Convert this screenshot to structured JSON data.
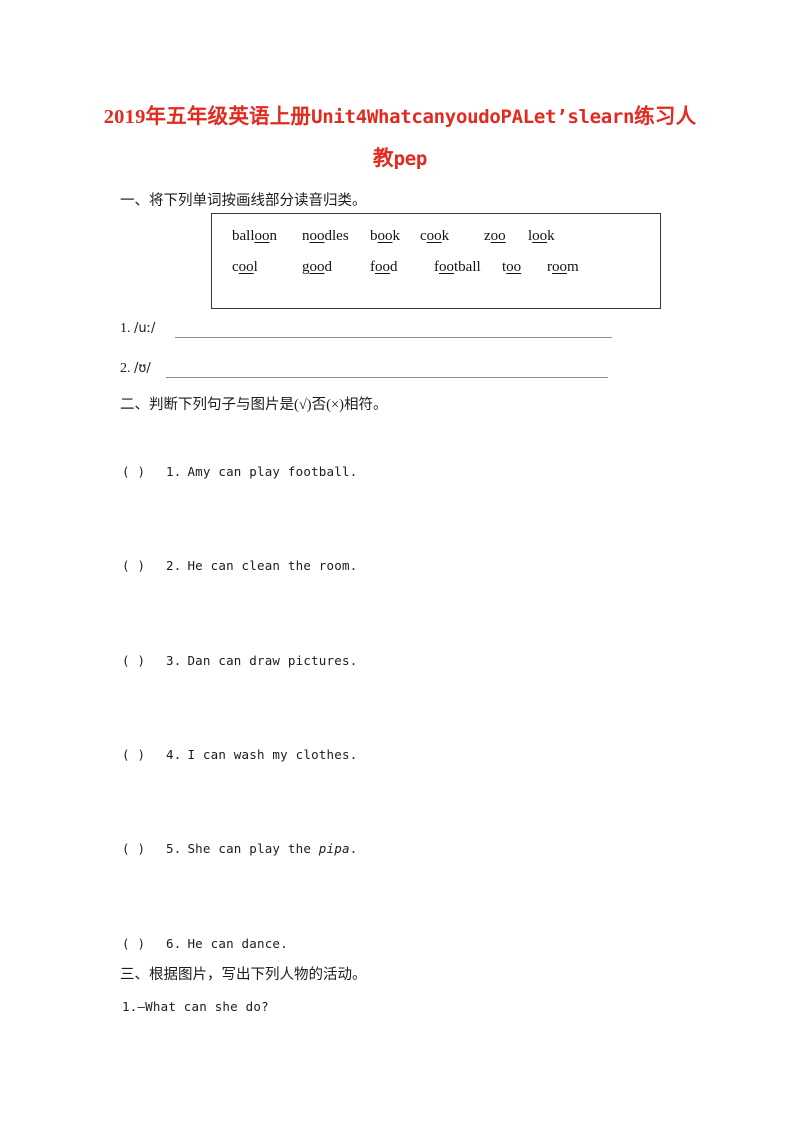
{
  "title": {
    "line1_pre": "2019",
    "line1_cn_a": "年五年级英语上册",
    "line1_en": "Unit4WhatcanyoudoPALet’slearn",
    "line1_cn_b": "练习人",
    "line2_cn": "教",
    "line2_en": "pep",
    "color": "#e12b20"
  },
  "sections": {
    "one": {
      "heading": "一、将下列单词按画线部分读音归类。",
      "word_bank": {
        "row1": [
          {
            "pre": "ball",
            "mark": "oo",
            "post": "n"
          },
          {
            "pre": "n",
            "mark": "oo",
            "post": "dles"
          },
          {
            "pre": "b",
            "mark": "oo",
            "post": "k"
          },
          {
            "pre": "c",
            "mark": "oo",
            "post": "k"
          },
          {
            "pre": "z",
            "mark": "oo",
            "post": ""
          },
          {
            "pre": "l",
            "mark": "oo",
            "post": "k"
          }
        ],
        "row2": [
          {
            "pre": "c",
            "mark": "oo",
            "post": "l"
          },
          {
            "pre": "g",
            "mark": "oo",
            "post": "d"
          },
          {
            "pre": "f",
            "mark": "oo",
            "post": "d"
          },
          {
            "pre": "f",
            "mark": "oo",
            "post": "tball"
          },
          {
            "pre": "t",
            "mark": "oo",
            "post": ""
          },
          {
            "pre": "r",
            "mark": "oo",
            "post": "m"
          }
        ]
      },
      "answers": [
        {
          "num": "1.",
          "symbol": "/uː/"
        },
        {
          "num": "2.",
          "symbol": "/ʊ/"
        }
      ]
    },
    "two": {
      "heading": "二、判断下列句子与图片是(√)否(×)相符。",
      "items": [
        {
          "num": "1.",
          "text": "Amy can play football.",
          "italic": ""
        },
        {
          "num": "2.",
          "text": "He can clean the room.",
          "italic": ""
        },
        {
          "num": "3.",
          "text": "Dan can draw pictures.",
          "italic": ""
        },
        {
          "num": "4.",
          "text": "I can wash my clothes.",
          "italic": ""
        },
        {
          "num": "5.",
          "text": "She can play the ",
          "italic": "pipa",
          "tail": "."
        },
        {
          "num": "6.",
          "text": "He can dance.",
          "italic": ""
        }
      ],
      "bracket": "(        )"
    },
    "three": {
      "heading": "三、根据图片，写出下列人物的活动。",
      "items": [
        {
          "num": "1.",
          "text": "—What can she do?"
        }
      ]
    }
  }
}
